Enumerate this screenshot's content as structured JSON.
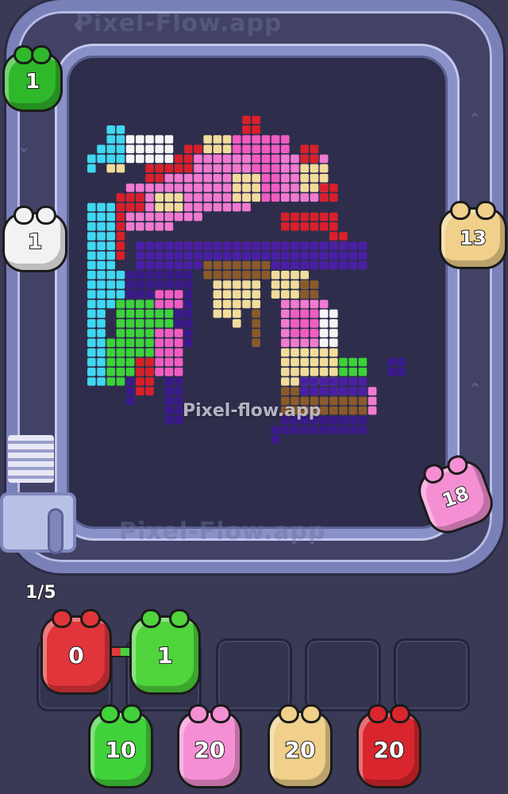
{
  "watermark": {
    "top": "Pixel-Flow.app",
    "center": "Pixel-flow.app",
    "bottom": "Pixel-Flow.app"
  },
  "progress": {
    "label": "1/5",
    "current": 1,
    "total": 5
  },
  "track_shooters": [
    {
      "id": "green-top-left",
      "count": "1",
      "color": "#2fb82a"
    },
    {
      "id": "white-left",
      "count": "1",
      "color": "#f2f2f5"
    },
    {
      "id": "tan-right",
      "count": "13",
      "color": "#f0d08a"
    },
    {
      "id": "pink-bottom-right",
      "count": "18",
      "color": "#f58fd4"
    }
  ],
  "slots": [
    {
      "count": "0",
      "color": "#e0353a",
      "filled": true
    },
    {
      "count": "1",
      "color": "#4fd43c",
      "filled": true
    },
    {
      "filled": false
    },
    {
      "filled": false
    },
    {
      "filled": false
    }
  ],
  "queue": [
    {
      "count": "10",
      "color": "#40d23a"
    },
    {
      "count": "20",
      "color": "#f58fd4"
    },
    {
      "count": "20",
      "color": "#f0d08a"
    },
    {
      "count": "20",
      "color": "#d9262e"
    }
  ],
  "palette": {
    "cyan": "#3fd8f0",
    "white": "#f4f4f4",
    "cream": "#f1dc9a",
    "red": "#d8202a",
    "pink": "#f07ad0",
    "hotpink": "#f25cc2",
    "purple": "#4a1fa6",
    "darkpurple": "#3a1a8a",
    "green": "#3cd23a",
    "brown": "#8a5a2a",
    "tan": "#d7b06a"
  }
}
